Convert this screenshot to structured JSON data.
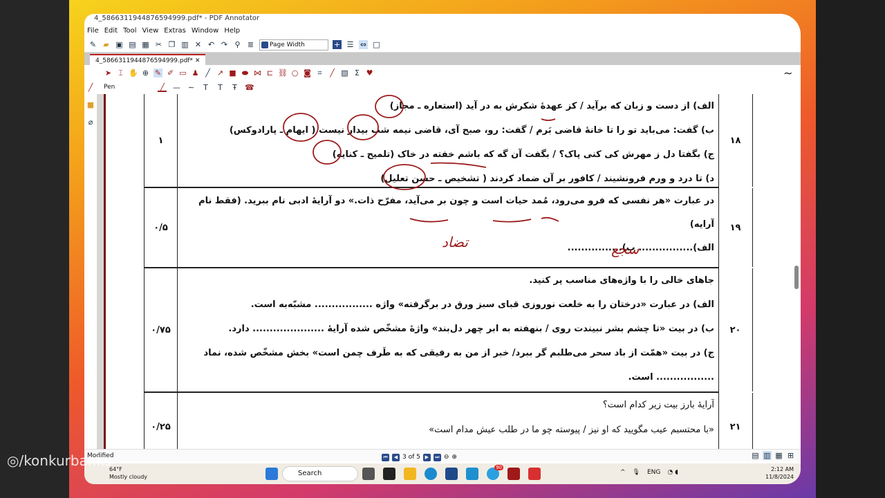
{
  "window": {
    "title": "4_5866311944876594999.pdf* - PDF Annotator"
  },
  "menu": [
    "File",
    "Edit",
    "Tool",
    "View",
    "Extras",
    "Window",
    "Help"
  ],
  "toolbar": {
    "zoom_value": "Page Width"
  },
  "tab": {
    "label": "4_5866311944876594999.pdf*"
  },
  "annotation_toolbar": {
    "tool_name": "Pen"
  },
  "questions": [
    {
      "number": "۱۸",
      "score": "۱",
      "lines": [
        "الف) از دست و زبان که برآید / کز عهدهٔ شکرش به در آید (استعاره ـ مجاز)",
        "ب) گفت: می‌باید تو را تا خانهٔ قاضی بَرم / گفت: رو، صبح آی، قاضی نیمه شب بیدار نیست ( ایهام ـ پارادوکس)",
        "ج) بگفتا دل ز مهرش کی کنی پاک؟ / بگفت آن گه که باشم خفته در خاک (تلمیح ـ کنایه)",
        "د) تا درد و ورم فرونشیند / کافور بر آن ضماد کردند ( تشخیص ـ حسن تعلیل)"
      ]
    },
    {
      "number": "۱۹",
      "score": "۰/۵",
      "lines": [
        "در عبارت «هر نفسی که فرو می‌رود، مُمد حیات است و چون بر می‌آید، مفرّح ذات.» دو آرایهٔ ادبی نام ببرید. (فقط نام",
        "آرایه)",
        "الف)................ ب)................"
      ],
      "handwriting": [
        "سجع",
        "تضاد"
      ]
    },
    {
      "number": "۲۰",
      "score": "۰/۷۵",
      "lines": [
        "جاهای خالی را با واژه‌های مناسب پر کنید.",
        "الف) در عبارت «درختان را به خلعت نوروزی قبای سبز ورق در برگرفته» واژه ................. مشبّه‌به است.",
        "ب) در بیت «تا چشم بشر نبیندت روی / بنهفته به ابر چهر دل‌بند» واژهٔ مشخّص شده آرایهٔ ..................... دارد.",
        "ج) در بیت «همّت از باد سحر می‌طلبم گر ببرد/ خبر از من به رفیقی که به طَرف چمن است» بخش مشخّص شده، نماد",
        "................. است."
      ]
    },
    {
      "number": "۲۱",
      "score": "۰/۲۵",
      "lines": [
        "آرایهٔ بارز بیت زیر کدام است؟",
        "«با محتسبم عیب مگویید که او نیز / پیوسته چو ما در طلب عیش مدام است»"
      ]
    }
  ],
  "status": {
    "text": "Modified",
    "page_indicator": "3 of 5"
  },
  "taskbar": {
    "weather_temp": "64°F",
    "weather_desc": "Mostly cloudy",
    "search_placeholder": "Search",
    "language": "ENG",
    "time": "2:12 AM",
    "date": "11/8/2024",
    "telegram_badge": "90"
  },
  "watermark": "/konkurbanks",
  "colors": {
    "annotation_red": "#9b1b1b",
    "page_border": "#7a1010"
  }
}
